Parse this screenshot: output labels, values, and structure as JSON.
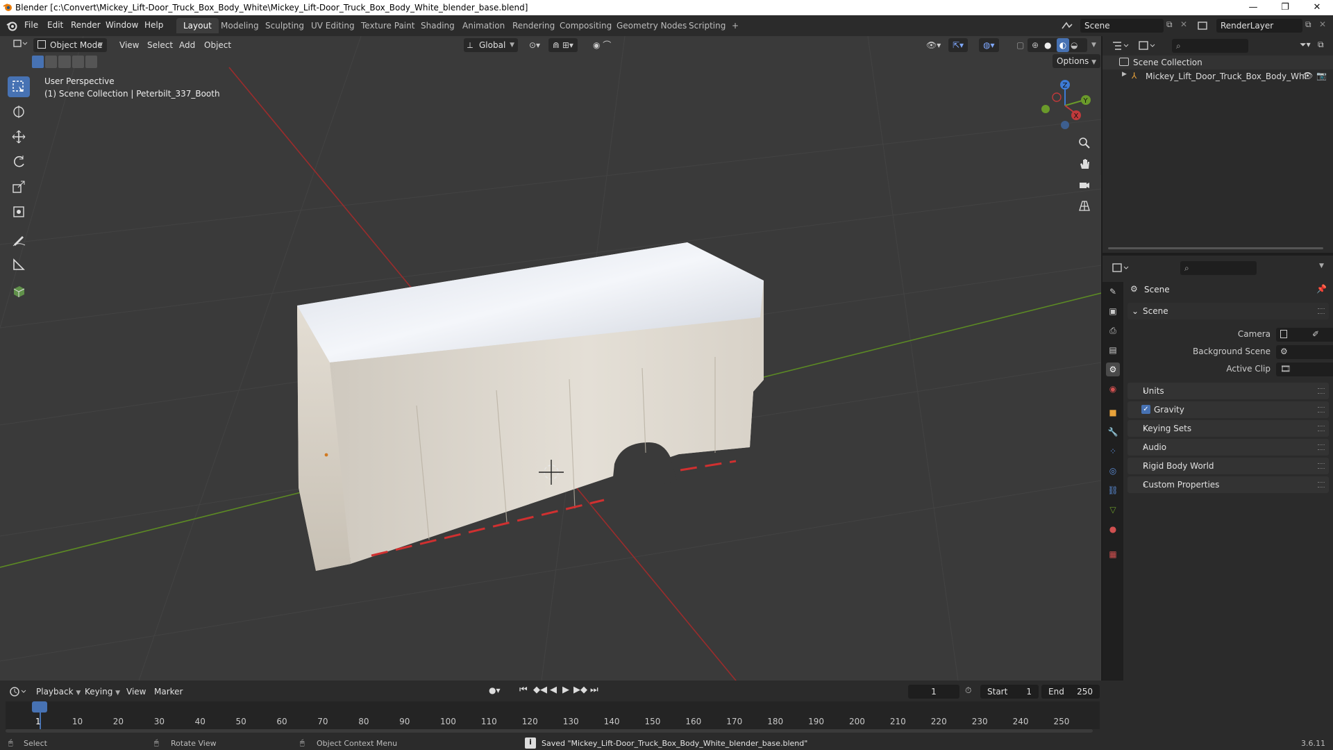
{
  "window": {
    "title": "Blender [c:\\Convert\\Mickey_Lift-Door_Truck_Box_Body_White\\Mickey_Lift-Door_Truck_Box_Body_White_blender_base.blend]",
    "minimize": "—",
    "maximize": "❐",
    "close": "✕"
  },
  "menu": [
    "File",
    "Edit",
    "Render",
    "Window",
    "Help"
  ],
  "workspaces": [
    "Layout",
    "Modeling",
    "Sculpting",
    "UV Editing",
    "Texture Paint",
    "Shading",
    "Animation",
    "Rendering",
    "Compositing",
    "Geometry Nodes",
    "Scripting",
    "+"
  ],
  "active_workspace": "Layout",
  "scene_field": "Scene",
  "renderlayer_field": "RenderLayer",
  "viewport_header": {
    "mode": "Object Mode",
    "menus": [
      "View",
      "Select",
      "Add",
      "Object"
    ],
    "orientation": "Global",
    "options": "Options"
  },
  "viewport_overlay": {
    "line1": "User Perspective",
    "line2": "(1) Scene Collection | Peterbilt_337_Booth"
  },
  "gizmo_axes": {
    "z": "Z",
    "y": "Y",
    "x": "X"
  },
  "outliner": {
    "root": "Scene Collection",
    "items": [
      {
        "name": "Mickey_Lift_Door_Truck_Box_Body_Whi"
      }
    ]
  },
  "properties": {
    "title": "Scene",
    "section": "Scene",
    "fields": [
      {
        "label": "Camera",
        "value": ""
      },
      {
        "label": "Background Scene",
        "value": ""
      },
      {
        "label": "Active Clip",
        "value": ""
      }
    ],
    "panels": [
      "Units",
      "Gravity",
      "Keying Sets",
      "Audio",
      "Rigid Body World",
      "Custom Properties"
    ],
    "gravity_checked": true
  },
  "timeline": {
    "menus": [
      "Playback",
      "Keying",
      "View",
      "Marker"
    ],
    "current_frame": "1",
    "start_label": "Start",
    "start": "1",
    "end_label": "End",
    "end": "250",
    "ruler": [
      "1",
      "10",
      "20",
      "30",
      "40",
      "50",
      "60",
      "70",
      "80",
      "90",
      "100",
      "110",
      "120",
      "130",
      "140",
      "150",
      "160",
      "170",
      "180",
      "190",
      "200",
      "210",
      "220",
      "230",
      "240",
      "250"
    ]
  },
  "statusbar": {
    "select": "Select",
    "rotate": "Rotate View",
    "context": "Object Context Menu",
    "message": "Saved \"Mickey_Lift-Door_Truck_Box_Body_White_blender_base.blend\"",
    "version": "3.6.11"
  },
  "colors": {
    "accent": "#4772b3",
    "x_axis": "#c0393b",
    "y_axis": "#6a9a2a",
    "z_axis": "#3d7bd6",
    "playhead": "#4772b3"
  }
}
